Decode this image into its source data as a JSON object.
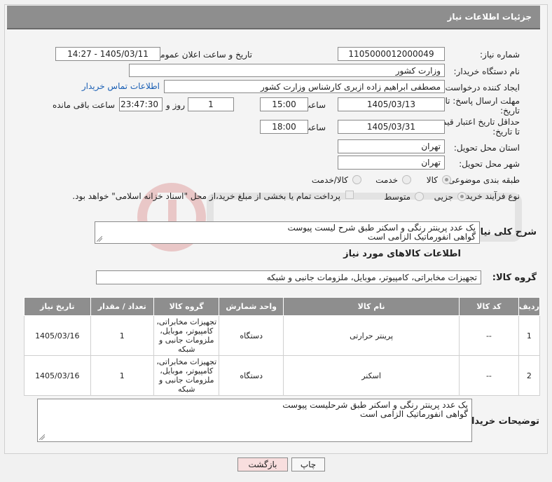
{
  "header": {
    "title": "جزئیات اطلاعات نیاز"
  },
  "form": {
    "need_number_label": "شماره نیاز:",
    "need_number": "1105000012000049",
    "announce_label": "تاریخ و ساعت اعلان عمومی:",
    "announce_value": "1405/03/11 - 14:27",
    "buyer_org_label": "نام دستگاه خریدار:",
    "buyer_org": "وزارت کشور",
    "requester_label": "ایجاد کننده درخواست:",
    "requester": "مصطفی ابراهیم زاده ازبری کارشناس وزارت کشور",
    "contact_link": "اطلاعات تماس خریدار",
    "deadline_label_1": "مهلت ارسال پاسخ: تا",
    "deadline_label_2": "تاریخ:",
    "deadline_date": "1405/03/13",
    "time_label": "ساعت",
    "deadline_time": "15:00",
    "days_value": "1",
    "days_label": "روز و",
    "remaining_time": "23:47:30",
    "remaining_label": "ساعت باقی مانده",
    "validity_label_1": "حداقل تاریخ اعتبار قیمت:",
    "validity_label_2": "تا تاریخ:",
    "validity_date": "1405/03/31",
    "validity_time": "18:00",
    "province_label": "استان محل تحویل:",
    "province": "تهران",
    "city_label": "شهر محل تحویل:",
    "city": "تهران",
    "category_label": "طبقه بندی موضوعی:",
    "category_options": [
      "کالا",
      "خدمت",
      "کالا/خدمت"
    ],
    "category_selected": "کالا",
    "process_label": "نوع فرآیند خرید :",
    "process_options": [
      "جزیی",
      "متوسط"
    ],
    "process_selected": "جزیی",
    "payment_note": "پرداخت تمام یا بخشی از مبلغ خرید،از محل \"اسناد خزانه اسلامی\" خواهد بود.",
    "summary_label": "شرح کلی نیاز:",
    "summary_lines": [
      "یک عدد پرینتر رنگی و اسکنر طبق شرح لیست پیوست",
      "گواهی انفورماتیک الزامی است"
    ],
    "goods_section_title": "اطلاعات کالاهای مورد نیاز",
    "goods_group_label": "گروه کالا:",
    "goods_group": "تجهیزات مخابراتی، کامپیوتر، موبایل، ملزومات جانبی و شبکه",
    "buyer_notes_label": "توضیحات خریدار:",
    "buyer_notes_lines": [
      "یک عدد پرینتر رنگی و اسکنر طبق شرحلیست پیوست",
      "گواهی انفورماتیک الزامی است"
    ]
  },
  "table": {
    "headers": [
      "ردیف",
      "کد کالا",
      "نام کالا",
      "واحد شمارش",
      "گروه کالا",
      "تعداد / مقدار",
      "تاریخ نیاز"
    ],
    "rows": [
      {
        "row": "1",
        "code": "--",
        "name": "پرینتر حرارتی",
        "unit": "دستگاه",
        "group_lines": [
          "تجهیزات مخابراتی،",
          "کامپیوتر، موبایل،",
          "ملزومات جانبی و",
          "شبکه"
        ],
        "qty": "1",
        "date": "1405/03/16"
      },
      {
        "row": "2",
        "code": "--",
        "name": "اسکنر",
        "unit": "دستگاه",
        "group_lines": [
          "تجهیزات مخابراتی،",
          "کامپیوتر، موبایل،",
          "ملزومات جانبی و",
          "شبکه"
        ],
        "qty": "1",
        "date": "1405/03/16"
      }
    ]
  },
  "buttons": {
    "print": "چاپ",
    "back": "بازگشت"
  },
  "colors": {
    "header_bg": "#8e8e8e",
    "link": "#1a5fb4",
    "back_button_bg": "#f8dede"
  }
}
